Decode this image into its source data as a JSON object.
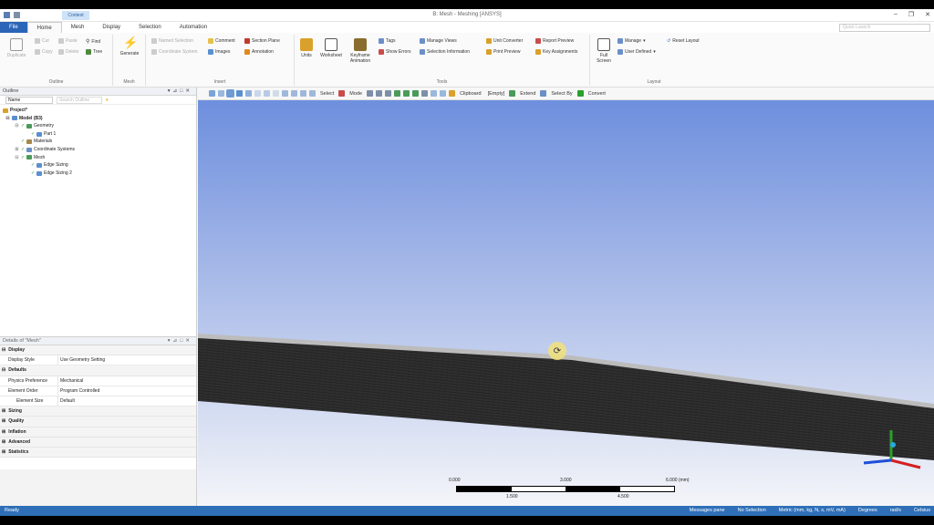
{
  "window": {
    "title": "B: Mesh - Meshing [ANSYS]",
    "context_tab": "Context",
    "controls": [
      "–",
      "❐",
      "✕"
    ]
  },
  "ribbon_tabs": [
    {
      "label": "File"
    },
    {
      "label": "Home"
    },
    {
      "label": "Mesh"
    },
    {
      "label": "Display"
    },
    {
      "label": "Selection"
    },
    {
      "label": "Automation"
    }
  ],
  "search_placeholder": "Quick Launch",
  "ribbon": {
    "outline_group": {
      "label": "Outline",
      "duplicate": "Duplicate",
      "cut": "Cut",
      "copy": "Copy",
      "paste": "Paste",
      "delete": "Delete",
      "find": "Find",
      "tree": "Tree"
    },
    "mesh_group": {
      "label": "Mesh",
      "generate": "Generate"
    },
    "insert_group": {
      "label": "Insert",
      "named_selection": "Named Selection",
      "coordinate_system": "Coordinate System",
      "comment": "Comment",
      "images": "Images",
      "section_plane": "Section Plane",
      "annotation": "Annotation"
    },
    "tools_group": {
      "label": "Tools",
      "units": "Units",
      "worksheet": "Worksheet",
      "keyframe_animation": "Keyframe Animation",
      "tags": "Tags",
      "show_errors": "Show Errors",
      "manage_views": "Manage Views",
      "selection_information": "Selection Information",
      "unit_converter": "Unit Converter",
      "print_preview": "Print Preview",
      "report_preview": "Report Preview",
      "key_assignments": "Key Assignments"
    },
    "layout_group": {
      "label": "Layout",
      "full_screen": "Full Screen",
      "manage": "Manage",
      "user_defined": "User Defined",
      "reset_layout": "Reset Layout"
    }
  },
  "outline": {
    "header": "Outline",
    "filter_selected": "Name",
    "search_placeholder": "Search Outline",
    "tree": [
      {
        "label": "Project*",
        "depth": 0,
        "bold": true
      },
      {
        "label": "Model (B3)",
        "depth": 1,
        "bold": true
      },
      {
        "label": "Geometry",
        "depth": 2
      },
      {
        "label": "Part 1",
        "depth": 3
      },
      {
        "label": "Materials",
        "depth": 2
      },
      {
        "label": "Coordinate Systems",
        "depth": 2
      },
      {
        "label": "Mesh",
        "depth": 2
      },
      {
        "label": "Edge Sizing",
        "depth": 3
      },
      {
        "label": "Edge Sizing 2",
        "depth": 3
      }
    ]
  },
  "details": {
    "header": "Details of \"Mesh\"",
    "rows": [
      {
        "type": "section",
        "label": "Display",
        "expanded": true
      },
      {
        "type": "prop",
        "key": "Display Style",
        "value": "Use Geometry Setting"
      },
      {
        "type": "section",
        "label": "Defaults",
        "expanded": true
      },
      {
        "type": "prop",
        "key": "Physics Preference",
        "value": "Mechanical"
      },
      {
        "type": "prop",
        "key": "Element Order",
        "value": "Program Controlled"
      },
      {
        "type": "prop",
        "key": "Element Size",
        "value": "Default"
      },
      {
        "type": "section",
        "label": "Sizing",
        "expanded": false
      },
      {
        "type": "section",
        "label": "Quality",
        "expanded": false
      },
      {
        "type": "section",
        "label": "Inflation",
        "expanded": false
      },
      {
        "type": "section",
        "label": "Advanced",
        "expanded": false
      },
      {
        "type": "section",
        "label": "Statistics",
        "expanded": false
      }
    ]
  },
  "graphics_toolbar": {
    "select": "Select",
    "mode": "Mode",
    "clipboard": "Clipboard",
    "empty": "[Empty]",
    "extend": "Extend",
    "select_by": "Select By",
    "convert": "Convert"
  },
  "scale_bar": {
    "labels_top": [
      "0.000",
      "3.000",
      "6.000 (mm)"
    ],
    "labels_bottom": [
      "1.500",
      "4.500"
    ]
  },
  "status": {
    "left": "Ready",
    "messages": "Messages pane",
    "selection": "No Selection",
    "units": "Metric (mm, kg, N, s, mV, mA)",
    "angle": "Degrees",
    "rate": "rad/s",
    "temp": "Celsius"
  },
  "colors": {
    "accent": "#2b65b8",
    "status_bar": "#2e6fb8",
    "viewport_top": "#6e8fde",
    "viewport_bottom": "#f4f5f9",
    "mesh": "#2a2a2a",
    "triad_x": "#d32020",
    "triad_y": "#2aa02a",
    "triad_z": "#1e4fd8"
  }
}
